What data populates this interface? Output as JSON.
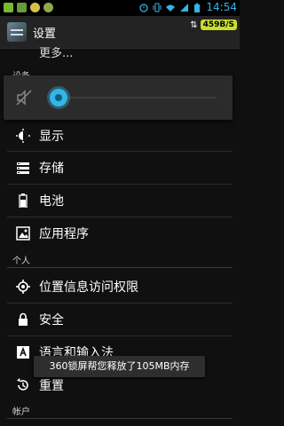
{
  "status_bar": {
    "time": "14:54",
    "icons": [
      "gallery-icon",
      "app-icon",
      "cat-icon",
      "sync-icon",
      "alarm-icon",
      "vibrate-icon",
      "wifi-icon",
      "signal-icon",
      "battery-icon"
    ]
  },
  "action_bar": {
    "title": "设置",
    "net_speed": "459B/S",
    "net_arrows": "⇅"
  },
  "partial_item_label": "更多...",
  "sections": {
    "device": "设备",
    "personal": "个人",
    "accounts": "帐户"
  },
  "items": [
    {
      "icon": "brightness-icon",
      "label": "显示"
    },
    {
      "icon": "storage-icon",
      "label": "存储"
    },
    {
      "icon": "battery-icon",
      "label": "电池"
    },
    {
      "icon": "apps-icon",
      "label": "应用程序"
    },
    {
      "icon": "location-icon",
      "label": "位置信息访问权限"
    },
    {
      "icon": "lock-icon",
      "label": "安全"
    },
    {
      "icon": "language-icon",
      "label": "语言和输入法"
    },
    {
      "icon": "reset-icon",
      "label": "重置"
    }
  ],
  "volume": {
    "level": 0,
    "muted": true
  },
  "toast": "360锁屏帮您释放了105MB内存",
  "colors": {
    "accent": "#33b5e5",
    "net_badge": "#c9dd2e",
    "background": "#101010"
  }
}
